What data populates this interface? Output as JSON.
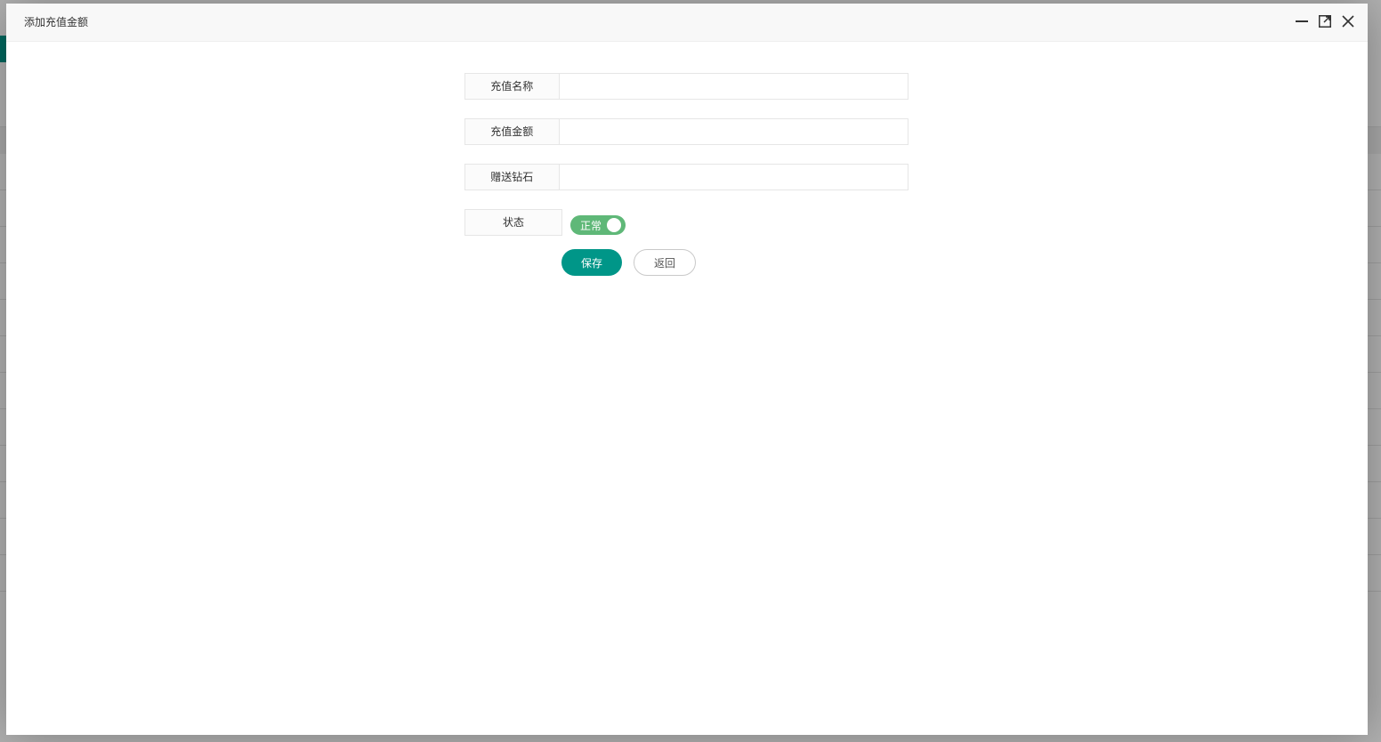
{
  "dialog": {
    "title": "添加充值金额"
  },
  "icons": {
    "minimize": "minimize-icon",
    "maximize": "maximize-icon",
    "close": "close-icon"
  },
  "form": {
    "fields": [
      {
        "label": "充值名称",
        "value": "",
        "placeholder": ""
      },
      {
        "label": "充值金额",
        "value": "",
        "placeholder": ""
      },
      {
        "label": "赠送钻石",
        "value": "",
        "placeholder": ""
      }
    ],
    "status": {
      "label": "状态",
      "switch_text": "正常",
      "checked": true
    }
  },
  "actions": {
    "save_label": "保存",
    "back_label": "返回"
  },
  "colors": {
    "primary": "#009688",
    "switch_on": "#5fb878"
  }
}
